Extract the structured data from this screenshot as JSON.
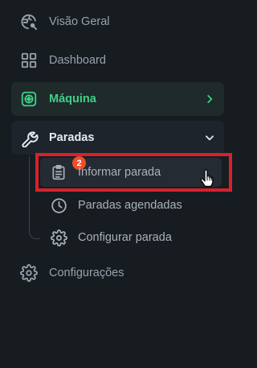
{
  "colors": {
    "background": "#171c21",
    "accent": "#3fd08a",
    "highlight": "#d6222c",
    "badge": "#ee4e2a"
  },
  "nav": {
    "items": [
      {
        "label": "Visão Geral",
        "icon": "globe-search-icon"
      },
      {
        "label": "Dashboard",
        "icon": "grid-icon"
      },
      {
        "label": "Máquina",
        "icon": "machine-icon",
        "state": "active"
      },
      {
        "label": "Paradas",
        "icon": "wrench-icon",
        "state": "expanded"
      },
      {
        "label": "Configurações",
        "icon": "gear-icon"
      }
    ]
  },
  "paradas_submenu": {
    "items": [
      {
        "label": "Informar parada",
        "icon": "clipboard-icon",
        "badge": "2"
      },
      {
        "label": "Paradas agendadas",
        "icon": "clock-icon"
      },
      {
        "label": "Configurar parada",
        "icon": "gear-icon"
      }
    ]
  }
}
